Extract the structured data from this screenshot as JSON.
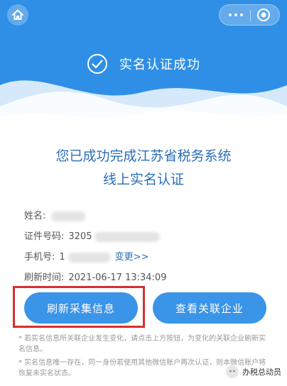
{
  "header": {
    "success_text": "实名认证成功"
  },
  "headline": {
    "line1": "您已成功完成江苏省税务系统",
    "line2": "线上实名认证"
  },
  "info": {
    "name_label": "姓名:",
    "id_label": "证件号码:",
    "id_prefix": "3205",
    "phone_label": "手机号:",
    "phone_prefix": "1",
    "change_link": "变更>>",
    "refresh_time_label": "刷新时间:",
    "refresh_time_value": "2021-06-17 13:34:09"
  },
  "buttons": {
    "refresh": "刷新采集信息",
    "view": "查看关联企业"
  },
  "notes": {
    "note1": "* 若实名信息所关联企业发生变化，请点击上方按钮，为变化的关联企业刷新实名信息。",
    "note2": "* 实名信息唯一存在，同一身份若使用其他微信账户再次认证，则本微信账户将恢复未实名状态。"
  },
  "watermark": {
    "text": "办税总动员"
  },
  "colors": {
    "hero_blue": "#2f8fe6",
    "button_blue": "#3a94e8",
    "headline_blue": "#2a6fb8",
    "highlight_red": "#d63030"
  },
  "icons": {
    "home": "home-icon",
    "more": "more-dots-icon",
    "close": "target-close-icon",
    "check": "check-circle-icon"
  }
}
